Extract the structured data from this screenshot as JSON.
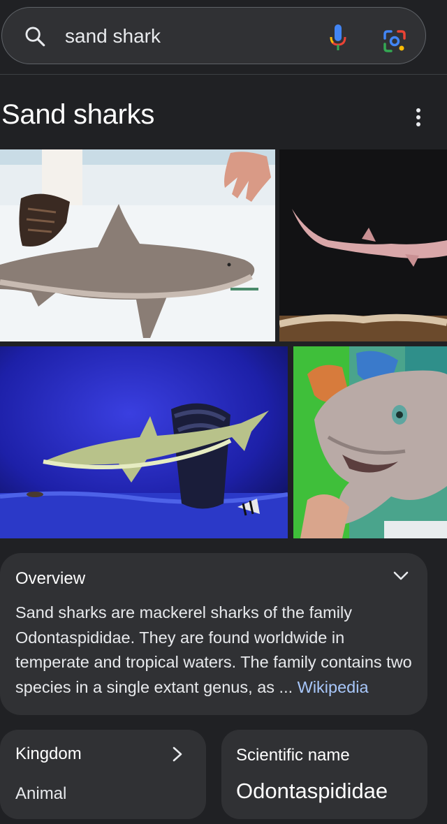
{
  "search": {
    "query": "sand shark",
    "icons": [
      "search-icon",
      "mic-icon",
      "lens-icon"
    ]
  },
  "results_header": {
    "title": "Sand sharks",
    "more_icon": "more-vert-icon"
  },
  "images": [
    {
      "name": "sand-shark-on-deck-image"
    },
    {
      "name": "sand-shark-swimming-dark-image"
    },
    {
      "name": "sand-shark-aquarium-image"
    },
    {
      "name": "sand-shark-closeup-image"
    }
  ],
  "overview": {
    "title": "Overview",
    "body": "Sand sharks are mackerel sharks of the family Odontaspididae. They are found worldwide in temperate and tropical waters. The family contains two species in a single extant genus, as ... ",
    "link": "Wikipedia"
  },
  "facts": [
    {
      "label": "Kingdom",
      "value": "Animal"
    },
    {
      "label": "Scientific name",
      "value": "Odontaspididae"
    }
  ],
  "colors": {
    "background": "#202124",
    "card": "#303134",
    "link": "#a8c7fa",
    "text": "#e8eaed"
  }
}
